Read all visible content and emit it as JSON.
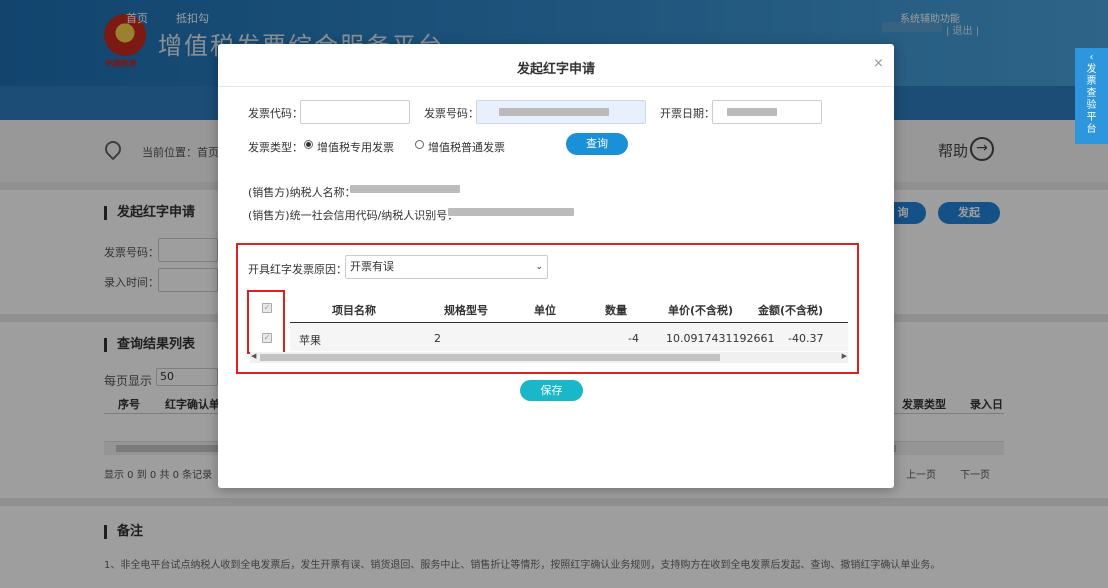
{
  "header": {
    "title": "增值税发票综合服务平台",
    "emblem_text": "中国税务",
    "logout": "| 退出 |"
  },
  "nav": {
    "items": [
      "首页",
      "抵扣勾",
      "系统辅助功能"
    ]
  },
  "side_tab": "发票查验平台",
  "breadcrumb": {
    "label": "当前位置：首页"
  },
  "help": {
    "label": "帮助"
  },
  "page": {
    "section_title": "发起红字申请",
    "fields": {
      "invoice_no": "发票号码：",
      "entry_time": "录入时间："
    },
    "buttons": {
      "query": "询",
      "initiate": "发起"
    },
    "results_title": "查询结果列表",
    "per_page": "每页显示",
    "per_page_value": "50",
    "columns": {
      "seq": "序号",
      "confirm_no": "红字确认单",
      "invoice_type": "发票类型",
      "entry_date": "录入日"
    },
    "pagination": {
      "summary": "显示 0 到 0 共 0 条记录",
      "prev": "上一页",
      "next": "下一页"
    },
    "notes_title": "备注",
    "note": "1、非全电平台试点纳税人收到全电发票后，发生开票有误、销货退回、服务中止、销售折让等情形，按照红字确认业务规则，支持购方在收到全电发票后发起、查询、撤销红字确认单业务。"
  },
  "modal": {
    "title": "发起红字申请",
    "close": "×",
    "invoice_code_label": "发票代码：",
    "invoice_no_label": "发票号码：",
    "issue_date_label": "开票日期：",
    "invoice_type_label": "发票类型：",
    "radio_options": [
      {
        "label": "增值税专用发票",
        "checked": true
      },
      {
        "label": "增值税普通发票",
        "checked": false
      }
    ],
    "query_button": "查询",
    "seller_name_label": "(销售方)纳税人名称：",
    "seller_id_label": "(销售方)统一社会信用代码/纳税人识别号：",
    "reason_label": "开具红字发票原因：",
    "reason_value": "开票有误",
    "table": {
      "headers": [
        "项目名称",
        "规格型号",
        "单位",
        "数量",
        "单价(不含税)",
        "金额(不含税)"
      ],
      "rows": [
        {
          "name": "苹果",
          "spec": "2",
          "unit": "",
          "qty": "-4",
          "price": "10.0917431192661",
          "amount": "-40.37"
        }
      ]
    },
    "save_button": "保存"
  },
  "colors": {
    "accent": "#1a90d6",
    "nav": "#2c7cbf",
    "highlight": "#e02020",
    "save": "#1ab7c9"
  }
}
